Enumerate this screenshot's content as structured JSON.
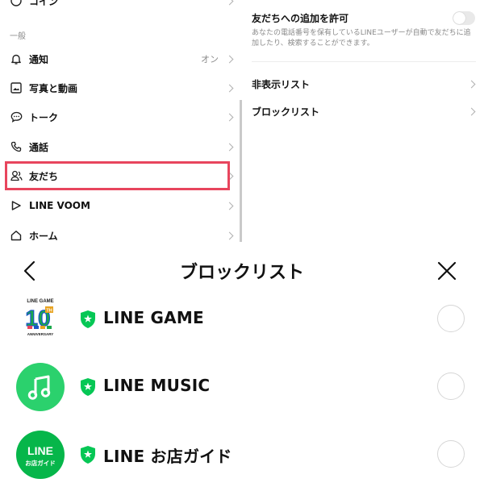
{
  "settings": {
    "section_header": "一般",
    "items": [
      {
        "label": "コイン",
        "icon": "coin-icon",
        "value": ""
      },
      {
        "label": "通知",
        "icon": "bell-icon",
        "value": "オン"
      },
      {
        "label": "写真と動画",
        "icon": "photo-icon",
        "value": ""
      },
      {
        "label": "トーク",
        "icon": "chat-icon",
        "value": ""
      },
      {
        "label": "通話",
        "icon": "phone-icon",
        "value": ""
      },
      {
        "label": "友だち",
        "icon": "friends-icon",
        "value": ""
      },
      {
        "label": "LINE VOOM",
        "icon": "voom-icon",
        "value": ""
      },
      {
        "label": "ホーム",
        "icon": "home-icon",
        "value": ""
      }
    ],
    "highlight_color": "#e8455d"
  },
  "friends_settings": {
    "allow_add_title": "友だちへの追加を許可",
    "allow_add_desc": "あなたの電話番号を保有しているLINEユーザーが自動で友だちに追加したり、検索することができます。",
    "allow_add_toggle": false,
    "hidden_list": "非表示リスト",
    "block_list": "ブロックリスト"
  },
  "block_list": {
    "title": "ブロックリスト",
    "items": [
      {
        "name": "LINE GAME",
        "logo": "line-game-logo",
        "selected": false
      },
      {
        "name": "LINE MUSIC",
        "logo": "line-music-logo",
        "selected": false
      },
      {
        "name": "LINE お店ガイド",
        "logo": "line-shop-guide-logo",
        "selected": false
      }
    ],
    "logos": {
      "line_game": {
        "top": "LINE GAME",
        "digits": "10",
        "suffix": "TH",
        "bottom": "ANNIVERSARY"
      },
      "line_shop_guide": {
        "top": "LINE",
        "bottom": "お店ガイド"
      }
    },
    "badge_color": "#06c755"
  }
}
